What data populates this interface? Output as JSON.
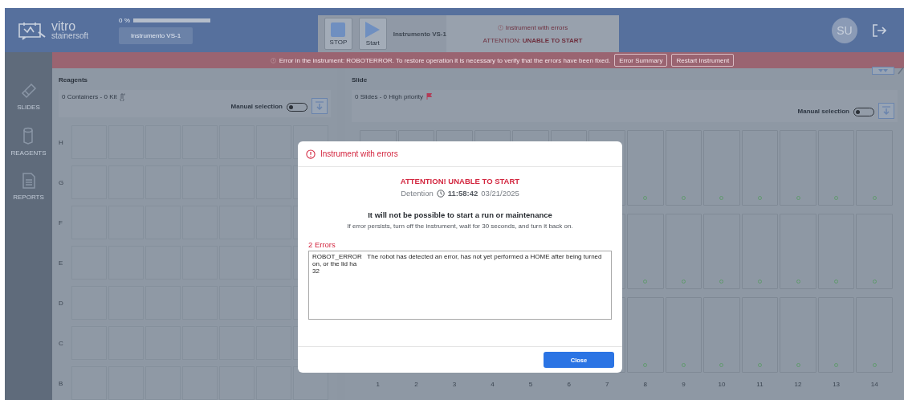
{
  "header": {
    "logo": {
      "name": "vitro",
      "tagline": "stainersoft"
    },
    "progress": {
      "reading": "0 %",
      "level": 0
    },
    "instrument_button": "Instrumento VS-1",
    "controls": [
      {
        "kind": "stop",
        "label": "STOP"
      },
      {
        "kind": "start",
        "label": "Start"
      }
    ],
    "instrument_name": "Instrumento VS-1",
    "status": {
      "title": "Instrument with errors",
      "message": "ATTENTION: **UNABLE TO START**"
    },
    "avatar": "SU"
  },
  "banner": {
    "message": "Error in the instrument: ROBOTERROR. To restore operation it is necessary to verify that the errors have been fixed.",
    "buttons": [
      "Error Summary",
      "Restart Instrument"
    ]
  },
  "sidebar": {
    "items": [
      {
        "kind": "slides",
        "label": "SLIDES"
      },
      {
        "kind": "reagents",
        "label": "REAGENTS"
      },
      {
        "kind": "reports",
        "label": "REPORTS"
      }
    ]
  },
  "reagents": {
    "title": "Reagents",
    "summary": "0 Containers - 0 Kit",
    "manual_selection": {
      "label": "Manual selection",
      "on": false
    },
    "rows": [
      "H",
      "G",
      "F",
      "E",
      "D",
      "C",
      "B"
    ]
  },
  "slide": {
    "title": "Slide",
    "summary": "0 Slides - 0 High priority",
    "manual_selection": {
      "label": "Manual selection",
      "on": false
    },
    "columns": [
      "1",
      "2",
      "3",
      "4",
      "5",
      "6",
      "7",
      "8",
      "9",
      "10",
      "11",
      "12",
      "13",
      "14"
    ]
  },
  "dialog": {
    "title": "Instrument with errors",
    "headline": "ATTENTION! UNABLE TO START",
    "detention_label": "Detention",
    "time": "11:58:42",
    "date": "03/21/2025",
    "warning": "It will not be possible to start a run or maintenance",
    "advice": "If error persists, turn off the instrument, wait for 30 seconds, and turn it back on.",
    "errors_label": "2 Errors",
    "error_lines": [
      "ROBOT_ERROR   The robot has detected an error, has not yet performed a HOME after being turned on, or the lid ha",
      "32"
    ],
    "close_button": "Close"
  }
}
